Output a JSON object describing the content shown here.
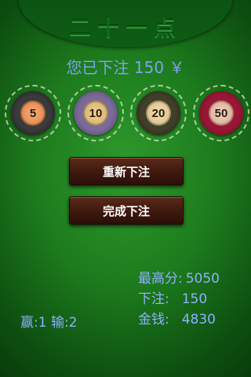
{
  "title": "二十一点",
  "bet_message": "您已下注 150 ￥",
  "chips": [
    {
      "value": "5",
      "color": "#2b2b2b"
    },
    {
      "value": "10",
      "color": "#6b5a8a"
    },
    {
      "value": "20",
      "color": "#30301c"
    },
    {
      "value": "50",
      "color": "#8a1230"
    }
  ],
  "buttons": {
    "rebet": "重新下注",
    "done": "完成下注"
  },
  "stats": {
    "high_score_label": "最高分:",
    "high_score_value": "5050",
    "bet_label": "下注:",
    "bet_value": "150",
    "money_label": "金钱:",
    "money_value": "4830"
  },
  "record": {
    "text": "赢:1 输:2"
  }
}
